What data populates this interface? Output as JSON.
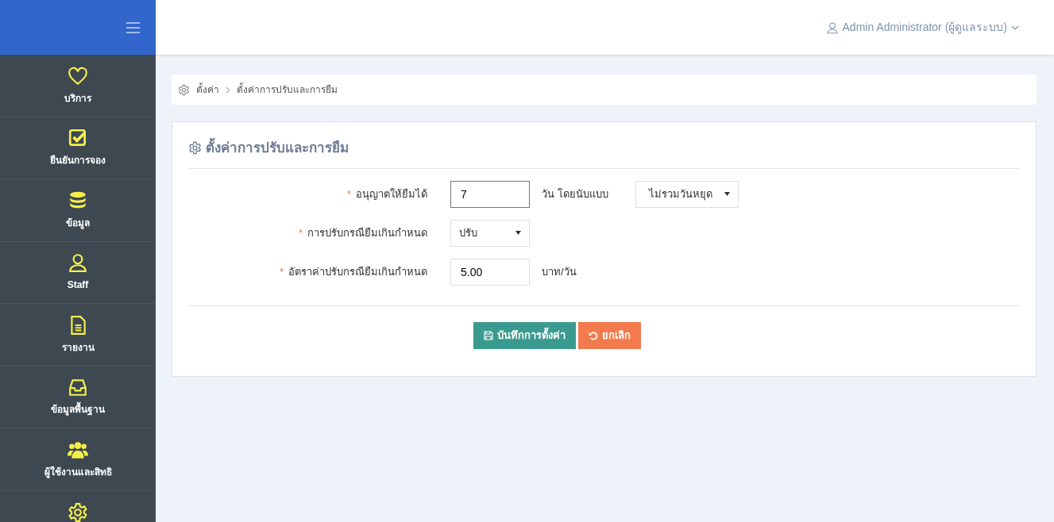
{
  "sidebar": {
    "items": [
      {
        "kind": "labeled",
        "label": "บริการ"
      },
      {
        "kind": "labeled",
        "label": "ยืนยันการจอง"
      },
      {
        "kind": "labeled",
        "label": "ข้อมูล"
      },
      {
        "kind": "labeled",
        "label": "Staff"
      },
      {
        "kind": "labeled",
        "label": "รายงาน"
      },
      {
        "kind": "labeled",
        "label": "ข้อมูลพื้นฐาน"
      },
      {
        "kind": "labeled",
        "label": "ผู้ใช้งานและสิทธิ"
      },
      {
        "kind": "icon_only"
      }
    ]
  },
  "user_menu": {
    "label": "Admin Administrator (ผู้ดูแลระบบ)"
  },
  "breadcrumb": [
    "ตั้งค่า",
    "ตั้งค่าการปรับและการยืม"
  ],
  "card": {
    "title": "ตั้งค่าการปรับและการยืม",
    "fields": [
      {
        "label": "อนุญาตให้ยืมได้",
        "required_mark": "*",
        "kind": "input",
        "value": "7",
        "focused": true,
        "unit": "วัน โดยนับแบบ",
        "extra_select": "ไม่รวมวันหยุด"
      },
      {
        "label": "การปรับกรณียืมเกินกำหนด",
        "required_mark": "*",
        "kind": "select",
        "value": "ปรับ"
      },
      {
        "label": "อัตราค่าปรับกรณียืมเกินกำหนด",
        "required_mark": "*",
        "kind": "input",
        "value": "5.00",
        "focused": false,
        "unit": "บาท/วัน"
      }
    ],
    "buttons": [
      {
        "label": "บันทึกการตั้งค่า",
        "kind": "save"
      },
      {
        "label": "ยกเลิก",
        "kind": "cancel"
      }
    ]
  }
}
